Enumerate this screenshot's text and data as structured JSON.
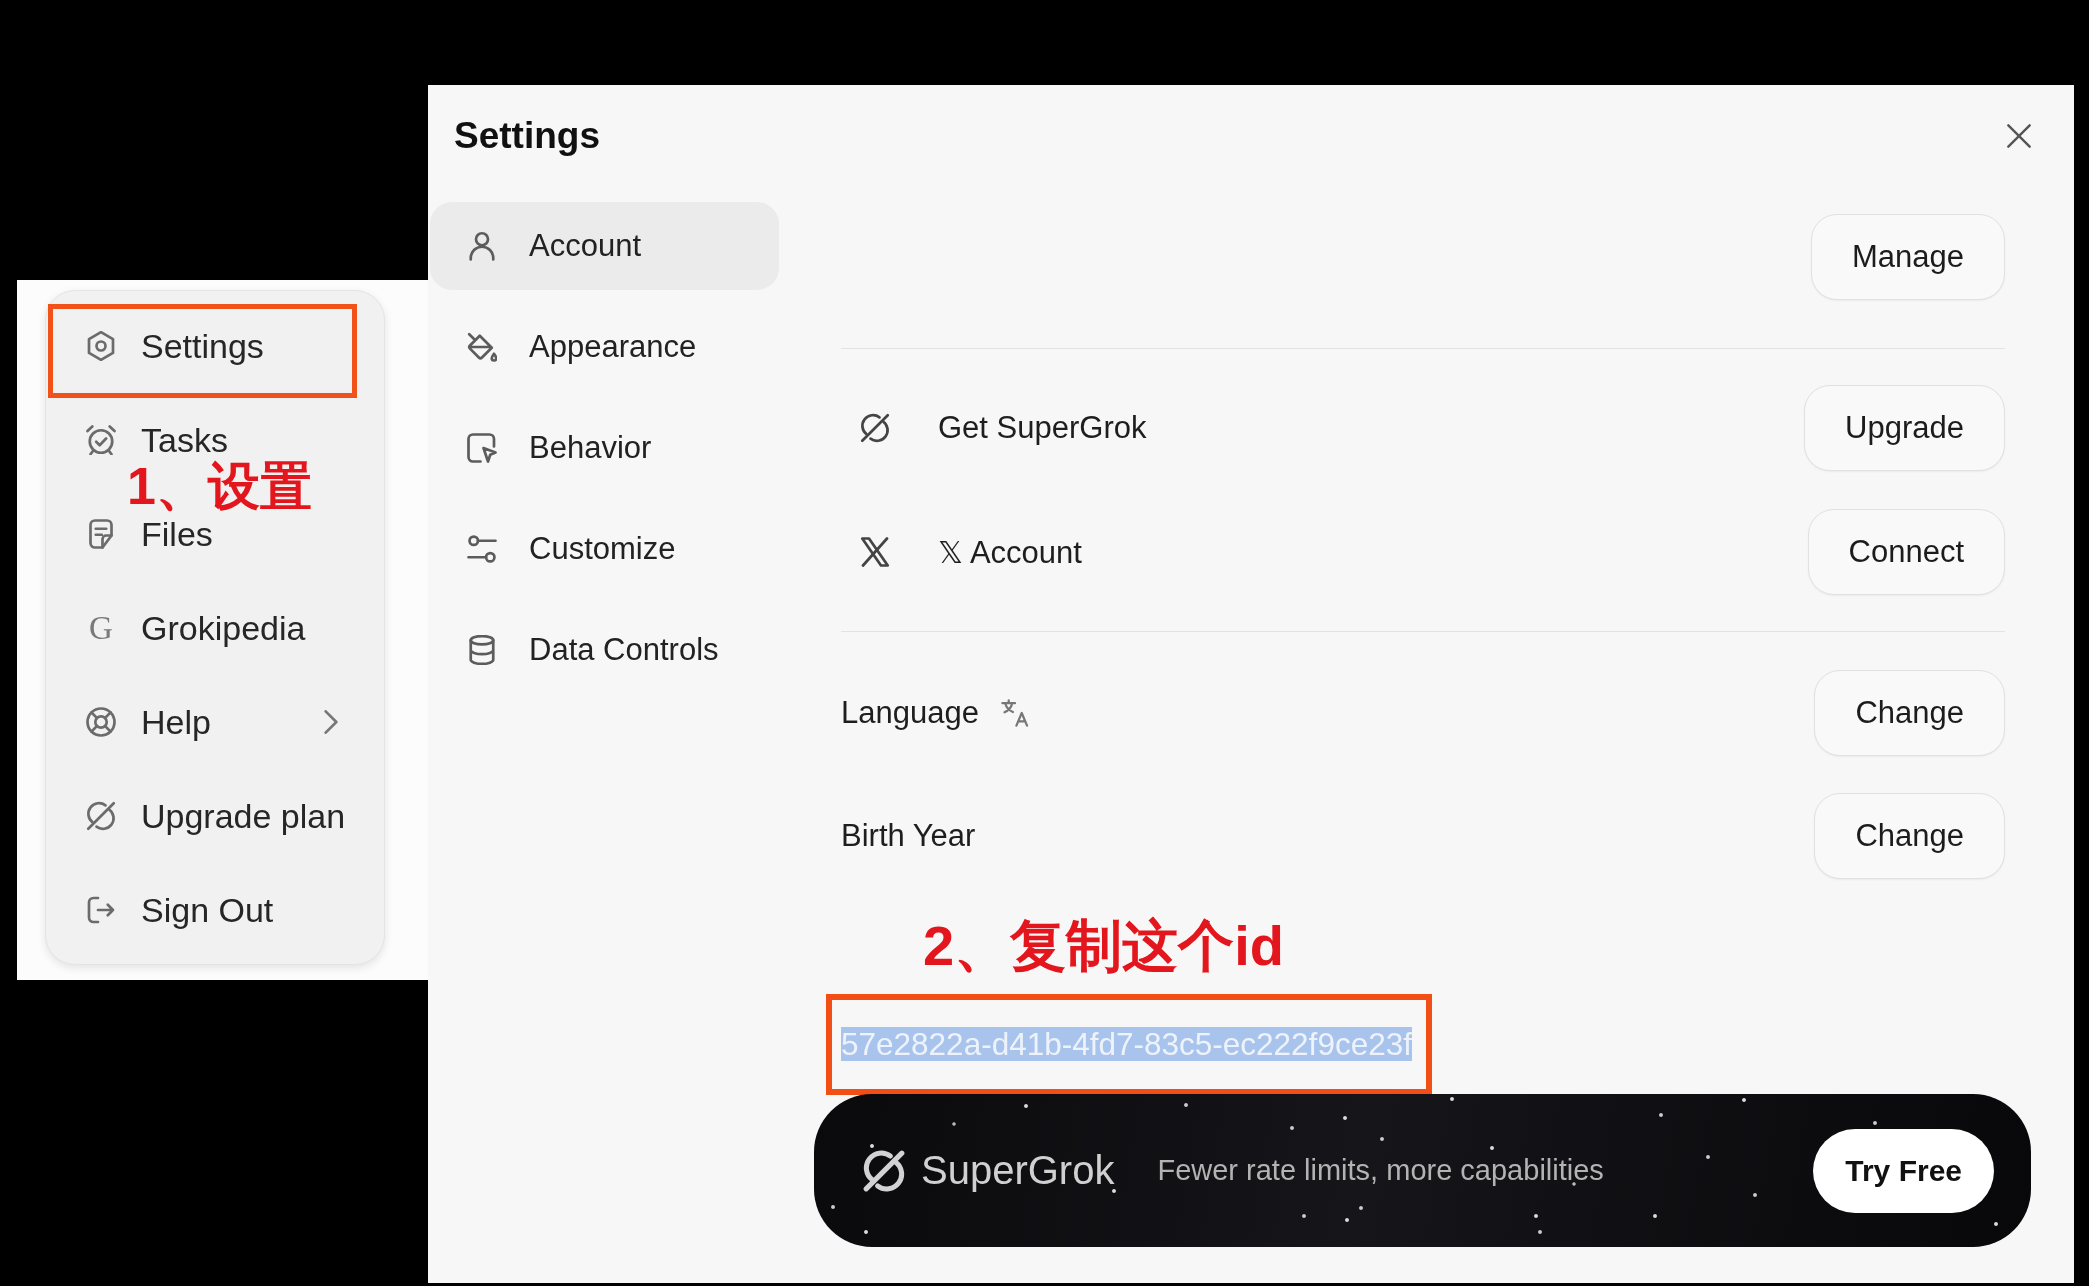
{
  "menu": {
    "items": [
      {
        "label": "Settings",
        "highlighted": true,
        "submenu": false
      },
      {
        "label": "Tasks",
        "highlighted": false,
        "submenu": false
      },
      {
        "label": "Files",
        "highlighted": false,
        "submenu": false
      },
      {
        "label": "Grokipedia",
        "glyph": "G",
        "highlighted": false,
        "submenu": false
      },
      {
        "label": "Help",
        "highlighted": false,
        "submenu": true
      },
      {
        "label": "Upgrade plan",
        "highlighted": false,
        "submenu": false
      },
      {
        "label": "Sign Out",
        "highlighted": false,
        "submenu": false
      }
    ],
    "annotation": "1、设置"
  },
  "dialog": {
    "title": "Settings",
    "nav": [
      {
        "label": "Account",
        "selected": true
      },
      {
        "label": "Appearance",
        "selected": false
      },
      {
        "label": "Behavior",
        "selected": false
      },
      {
        "label": "Customize",
        "selected": false
      },
      {
        "label": "Data Controls",
        "selected": false
      }
    ],
    "account": {
      "manage_button": "Manage",
      "links": [
        {
          "label": "Get SuperGrok",
          "button": "Upgrade"
        },
        {
          "label": "𝕏 Account",
          "button": "Connect"
        }
      ],
      "preferences": [
        {
          "label": "Language",
          "button": "Change"
        },
        {
          "label": "Birth Year",
          "button": "Change"
        }
      ],
      "annotation": "2、复制这个id",
      "user_id": {
        "text": "57e2822a-d41b-4fd7-83c5-ec222f9ce23f",
        "selected": true,
        "highlighted": true
      }
    },
    "banner": {
      "brand": "SuperGrok",
      "tagline": "Fewer rate limits, more capabilities",
      "button": "Try Free"
    }
  }
}
